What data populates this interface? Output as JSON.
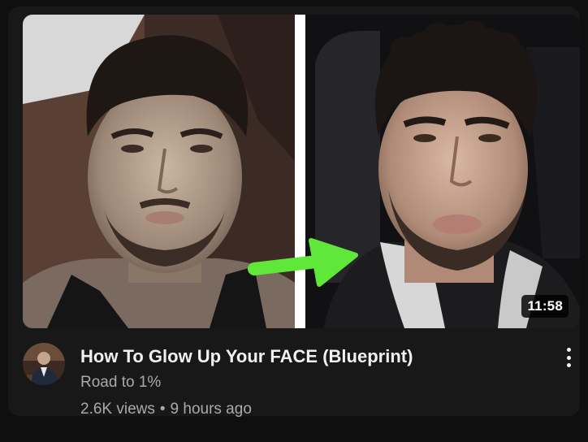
{
  "video": {
    "title": "How To Glow Up Your FACE (Blueprint)",
    "channel": "Road to 1%",
    "views": "2.6K views",
    "separator": "•",
    "age": "9 hours ago",
    "duration": "11:58"
  },
  "thumbnail": {
    "arrow_color": "#5fe83a",
    "divider_color": "#ffffff"
  },
  "icons": {
    "menu": "more-vert-icon",
    "avatar": "channel-avatar"
  }
}
